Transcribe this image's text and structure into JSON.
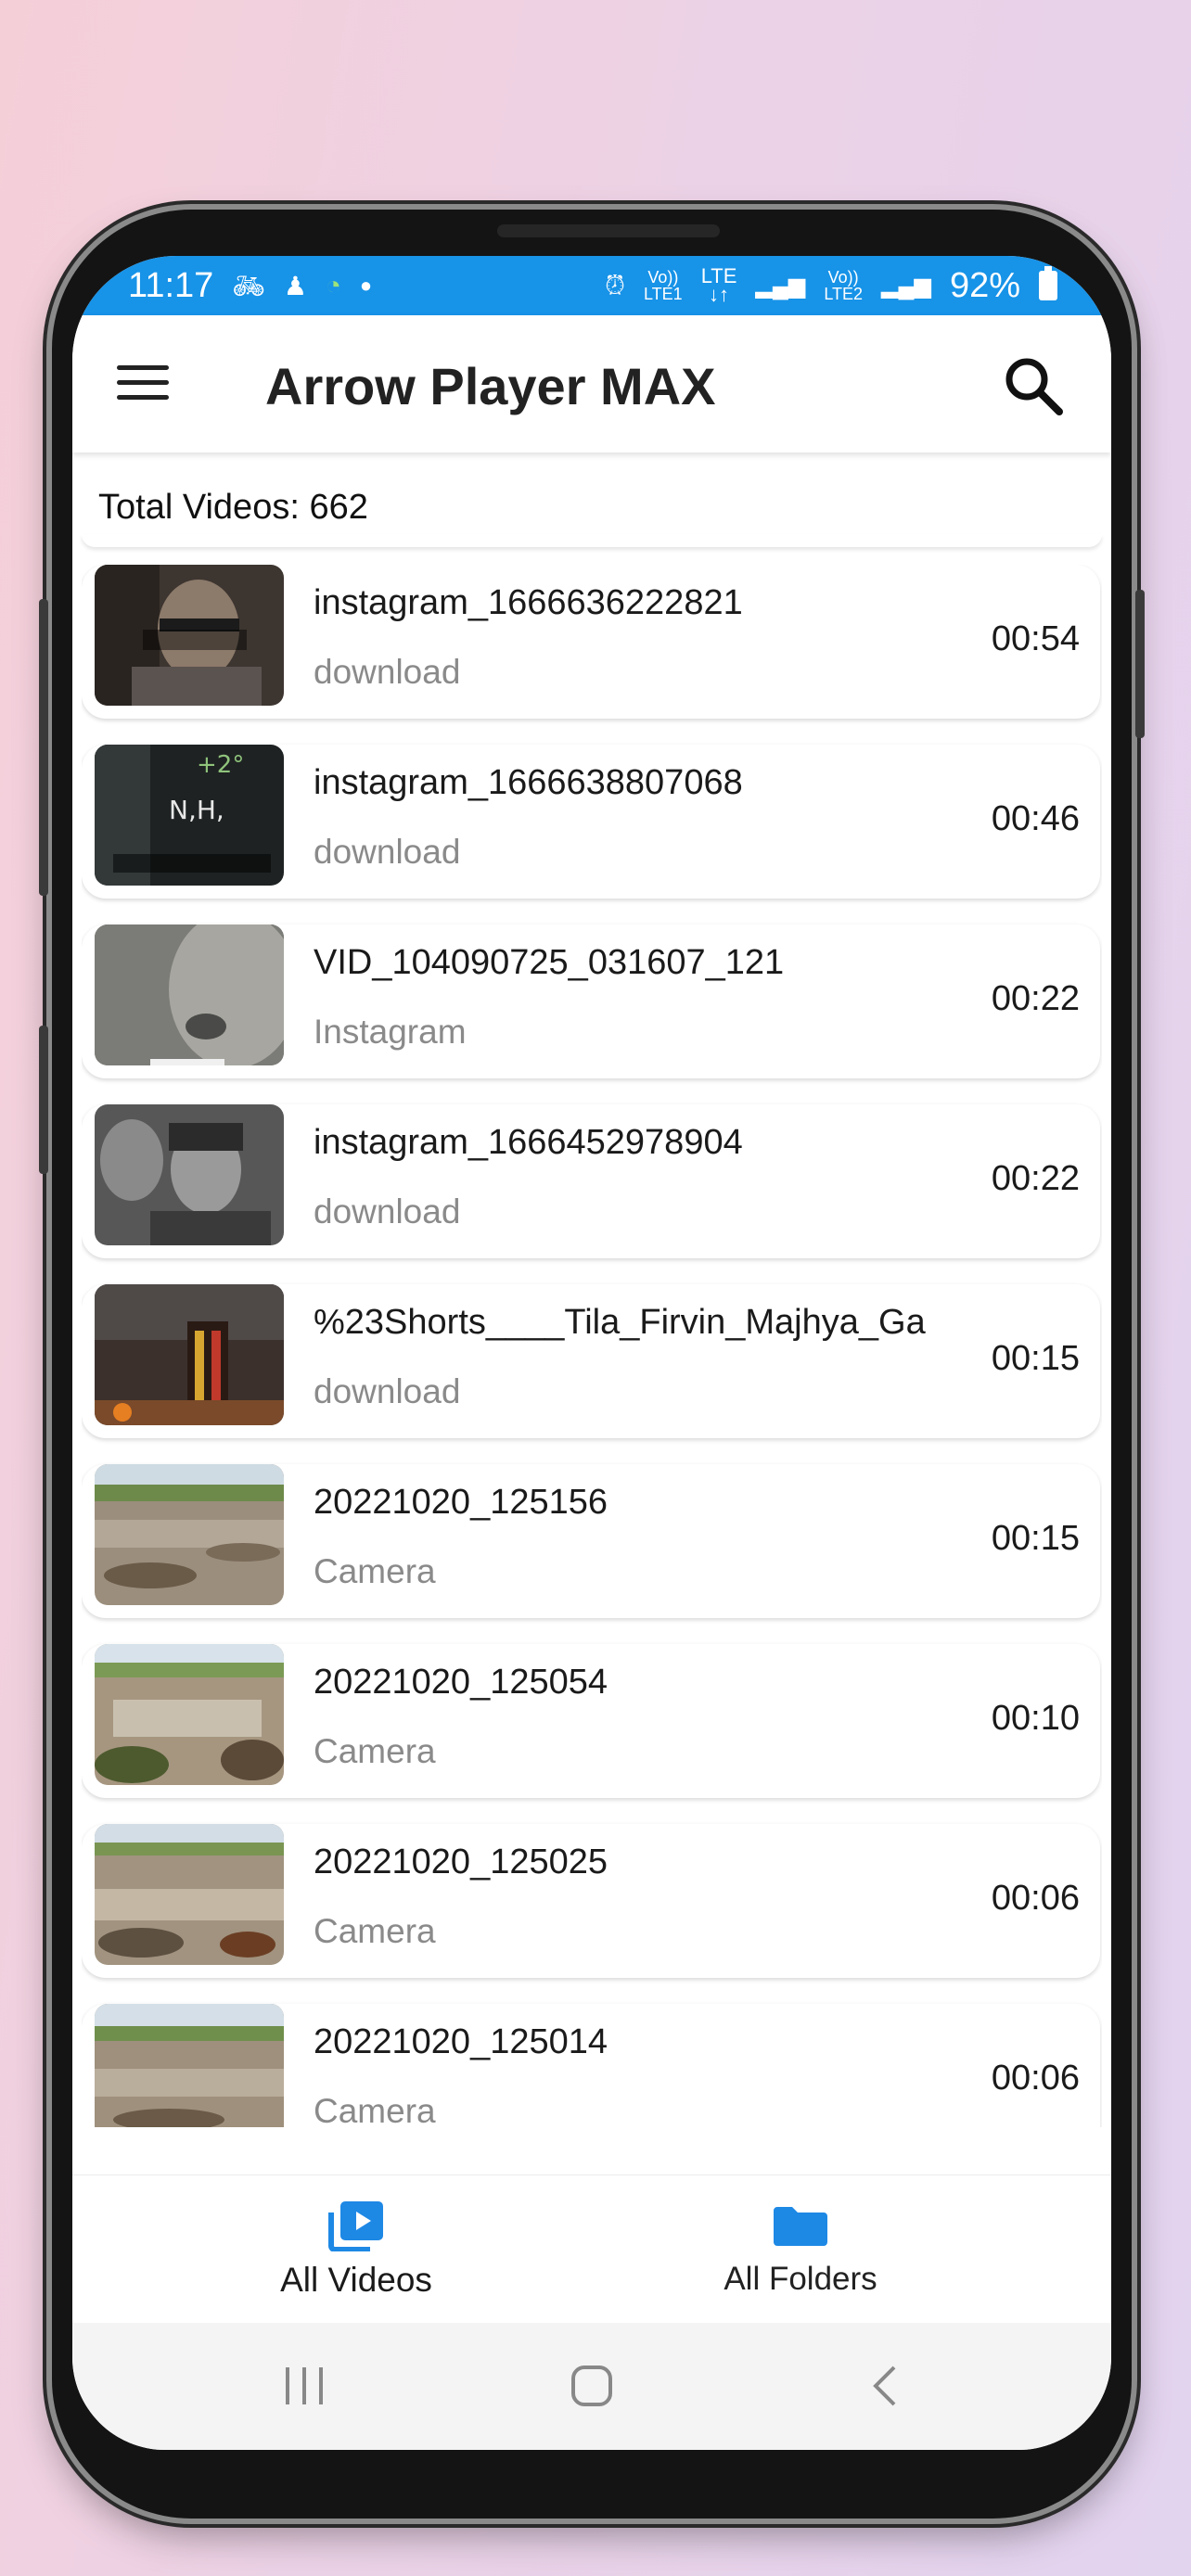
{
  "status_bar": {
    "time": "11:17",
    "left_icons": [
      "bike-icon",
      "person-icon",
      "sync-icon",
      "dot-icon"
    ],
    "sim1_top": "Vo))",
    "sim1_bottom": "LTE1",
    "lte_top": "LTE",
    "lte_bottom": "↓↑",
    "sim2_top": "Vo))",
    "sim2_bottom": "LTE2",
    "battery": "92%"
  },
  "app_bar": {
    "title": "Arrow Player MAX"
  },
  "summary": {
    "total_videos": "Total Videos: 662"
  },
  "videos": [
    {
      "name": "instagram_1666636222821",
      "folder": "download",
      "duration": "00:54"
    },
    {
      "name": "instagram_1666638807068",
      "folder": "download",
      "duration": "00:46"
    },
    {
      "name": "VID_104090725_031607_121",
      "folder": "Instagram",
      "duration": "00:22"
    },
    {
      "name": "instagram_1666452978904",
      "folder": "download",
      "duration": "00:22"
    },
    {
      "name": "%23Shorts____Tila_Firvin_Majhya_Ga",
      "folder": "download",
      "duration": "00:15"
    },
    {
      "name": "20221020_125156",
      "folder": "Camera",
      "duration": "00:15"
    },
    {
      "name": "20221020_125054",
      "folder": "Camera",
      "duration": "00:10"
    },
    {
      "name": "20221020_125025",
      "folder": "Camera",
      "duration": "00:06"
    },
    {
      "name": "20221020_125014",
      "folder": "Camera",
      "duration": "00:06"
    }
  ],
  "bottom_nav": {
    "items": [
      {
        "label": "All Videos",
        "icon": "video-library-icon",
        "selected": true
      },
      {
        "label": "All Folders",
        "icon": "folder-icon",
        "selected": false
      }
    ]
  },
  "colors": {
    "status_bar": "#1793e8",
    "accent": "#1e88e5"
  }
}
